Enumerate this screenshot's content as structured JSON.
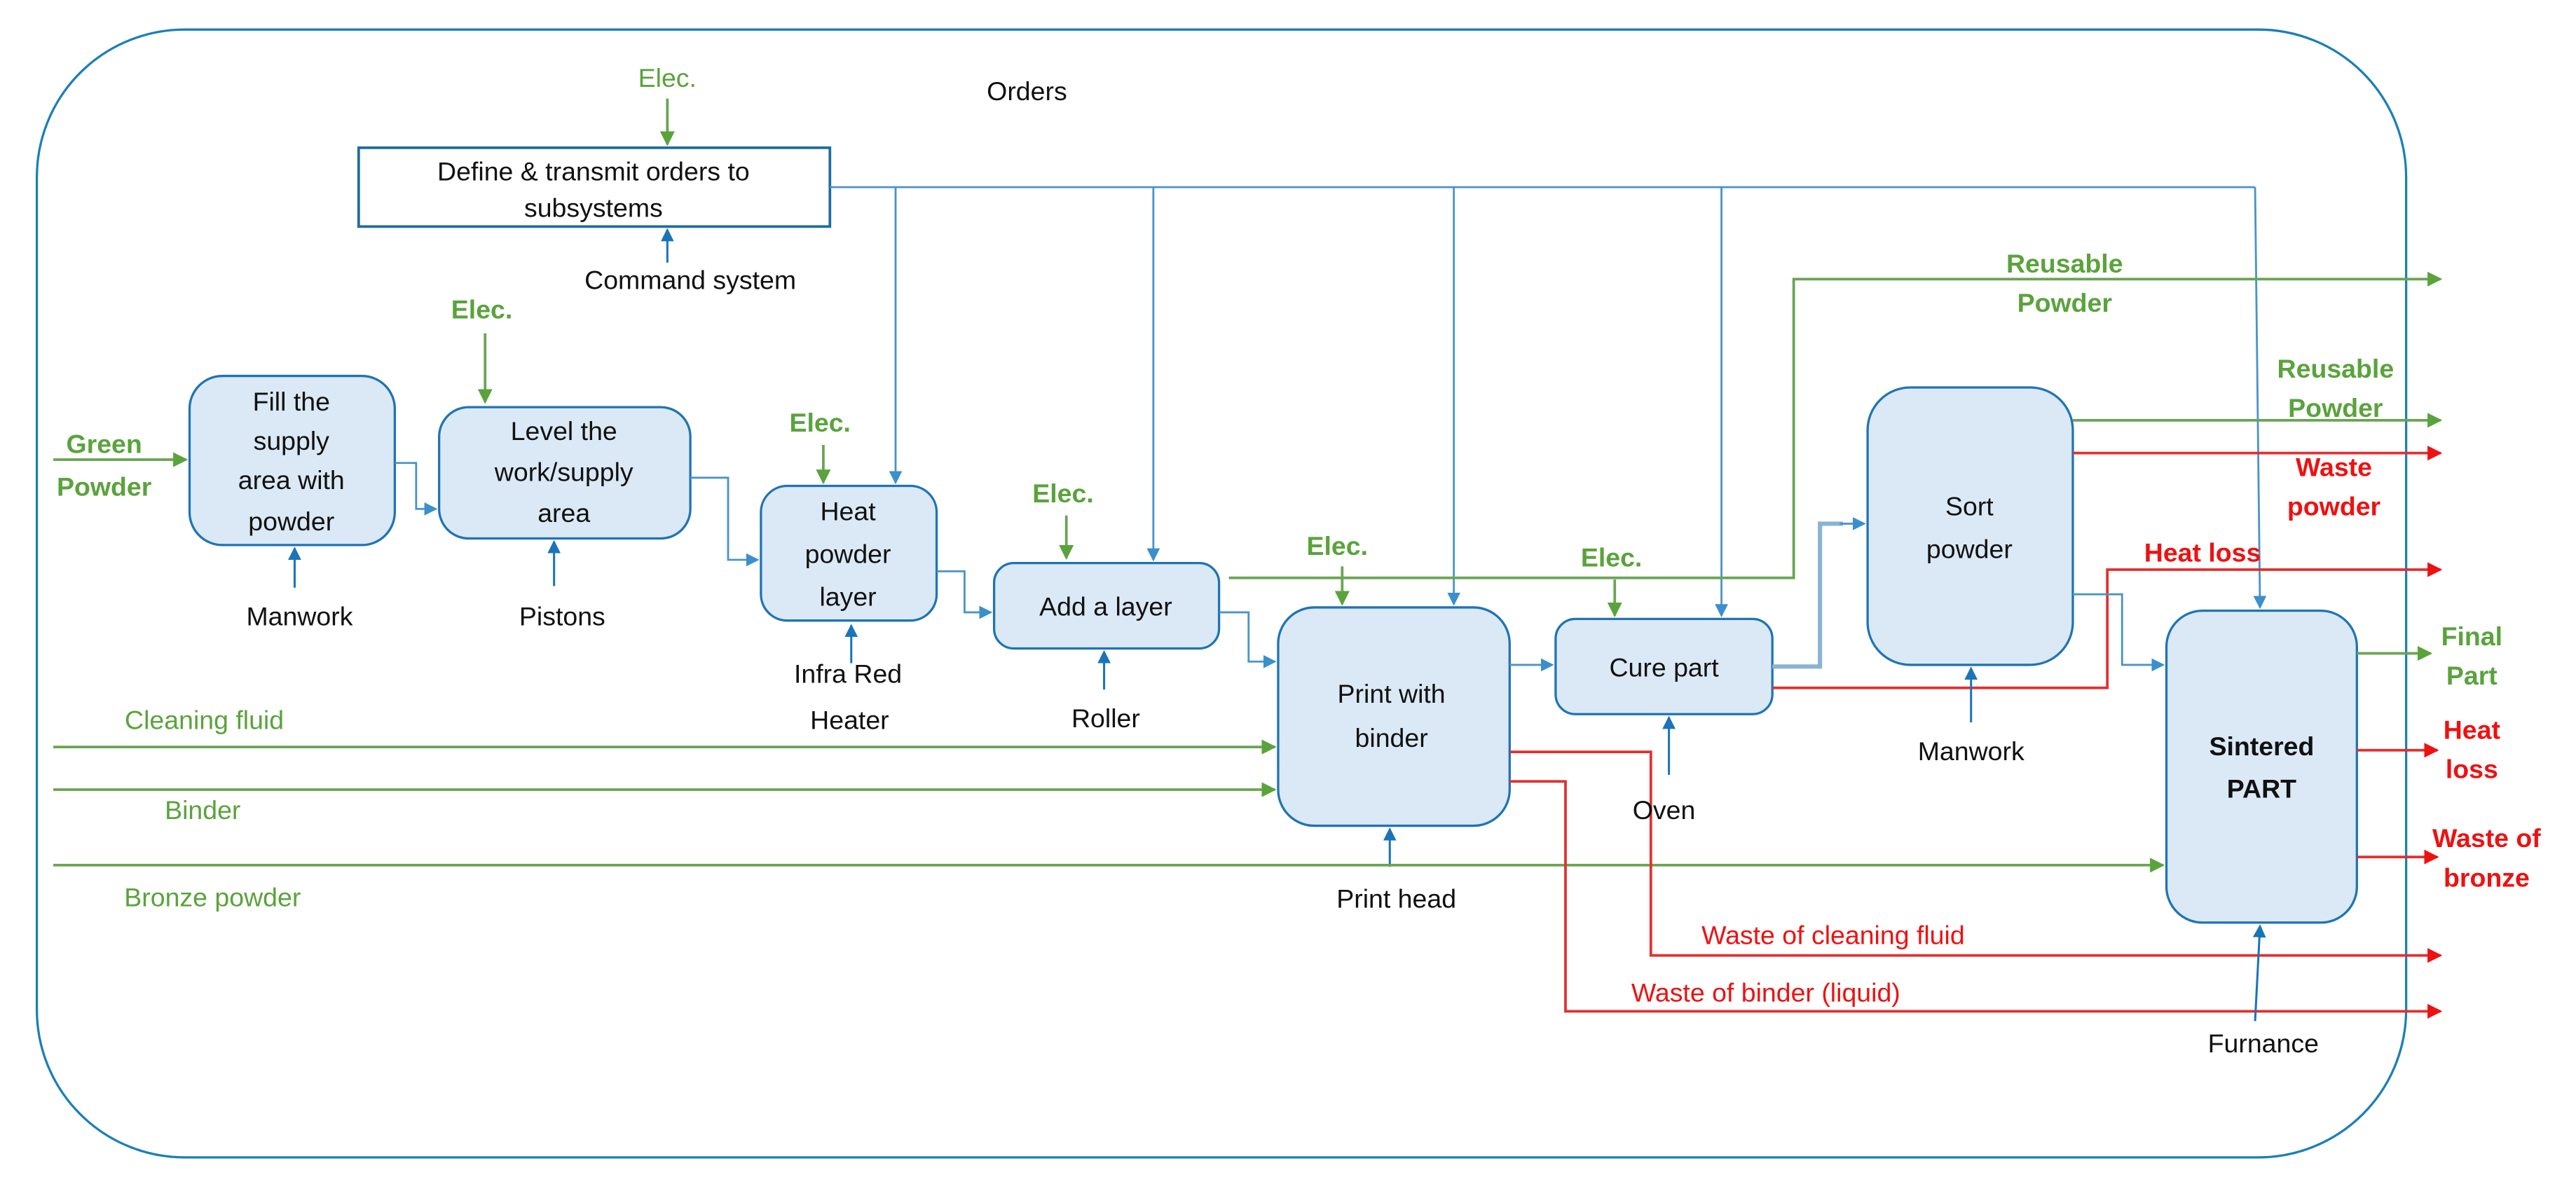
{
  "diagram": {
    "colors": {
      "process_fill": "#dbe9f6",
      "process_border": "#1f74b4",
      "control_flow": "#4a93c9",
      "resource_flow": "#5aa33c",
      "waste_flow": "#ee1111",
      "text": "#111111"
    },
    "orders_label": "Orders",
    "control": {
      "line1": "Define & transmit orders to",
      "line2": "subsystems",
      "input_elec": "Elec.",
      "mechanism": "Command system"
    },
    "processes": [
      {
        "id": "fill",
        "lines": [
          "Fill the",
          "supply",
          "area with",
          "powder"
        ],
        "mechanism": [
          "Manwork"
        ]
      },
      {
        "id": "level",
        "lines": [
          "Level the",
          "work/supply",
          "area"
        ],
        "mechanism": [
          "Pistons"
        ],
        "elec": "Elec."
      },
      {
        "id": "heat",
        "lines": [
          "Heat",
          "powder",
          "layer"
        ],
        "mechanism": [
          "Infra Red",
          "Heater"
        ],
        "elec": "Elec."
      },
      {
        "id": "add",
        "lines": [
          "Add a layer"
        ],
        "mechanism": [
          "Roller"
        ],
        "elec": "Elec."
      },
      {
        "id": "print",
        "lines": [
          "Print with",
          "binder"
        ],
        "mechanism": [
          "Print head"
        ],
        "elec": "Elec."
      },
      {
        "id": "cure",
        "lines": [
          "Cure part"
        ],
        "mechanism": [
          "Oven"
        ],
        "elec": "Elec."
      },
      {
        "id": "sort",
        "lines": [
          "Sort",
          "powder"
        ],
        "mechanism": [
          "Manwork"
        ]
      },
      {
        "id": "sinter",
        "lines": [
          "Sintered",
          "PART"
        ],
        "mechanism": [
          "Furnance"
        ]
      }
    ],
    "inputs": {
      "green_powder": [
        "Green",
        "Powder"
      ],
      "cleaning_fluid": "Cleaning fluid",
      "binder": "Binder",
      "bronze_powder": "Bronze powder"
    },
    "outputs": {
      "reusable_powder_top": [
        "Reusable",
        "Powder"
      ],
      "reusable_powder_sort": [
        "Reusable",
        "Powder"
      ],
      "waste_powder": [
        "Waste",
        "powder"
      ],
      "heat_loss_cure": "Heat loss",
      "final_part": [
        "Final",
        "Part"
      ],
      "heat_loss_sinter": [
        "Heat",
        "loss"
      ],
      "waste_bronze": [
        "Waste of",
        "bronze"
      ],
      "waste_cleaning_fluid": "Waste of cleaning fluid",
      "waste_binder": "Waste of binder (liquid)"
    }
  }
}
